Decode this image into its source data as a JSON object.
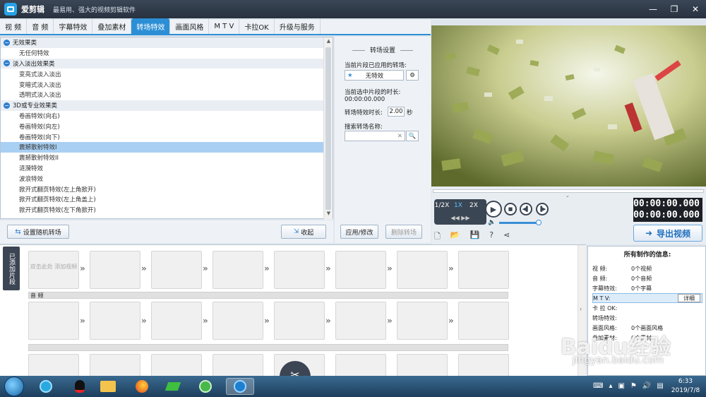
{
  "app": {
    "name": "爱剪辑",
    "slogan": "最易用、强大的视频剪辑软件"
  },
  "tabs": [
    {
      "label": "视  频"
    },
    {
      "label": "音  频"
    },
    {
      "label": "字幕特效"
    },
    {
      "label": "叠加素材"
    },
    {
      "label": "转场特效",
      "active": true
    },
    {
      "label": "画面风格"
    },
    {
      "label": "M T V"
    },
    {
      "label": "卡拉OK"
    },
    {
      "label": "升级与服务"
    }
  ],
  "effects": {
    "categories": [
      {
        "name": "无效果类",
        "items": [
          "无任何特效"
        ]
      },
      {
        "name": "淡入淡出效果类",
        "items": [
          "变亮式淡入淡出",
          "变暗式淡入淡出",
          "透明式淡入淡出"
        ]
      },
      {
        "name": "3D或专业效果类",
        "items": [
          "卷画特效(向右)",
          "卷画特效(向左)",
          "卷画特效(向下)",
          "震撼散射特效I",
          "震撼散射特效II",
          "涟漪特效",
          "波浪特效",
          "掀开式翻页特效(左上角掀开)",
          "掀开式翻页特效(左上角盖上)",
          "掀开式翻页特效(左下角掀开)"
        ]
      }
    ],
    "selected": "震撼散射特效I"
  },
  "left_buttons": {
    "random": "设置随机转场",
    "collapse": "收起"
  },
  "settings": {
    "heading": "转场设置",
    "applied_label": "当前片段已应用的转场:",
    "applied_value": "无特效",
    "duration_label": "当前选中片段的时长:",
    "duration_value": "00:00:00.000",
    "effect_duration_label": "转场特效时长:",
    "effect_duration_value": "2.00",
    "effect_duration_unit": "秒",
    "search_label": "搜索转场名称:",
    "search_value": "",
    "apply_button": "应用/修改",
    "delete_button": "删除转场"
  },
  "player": {
    "speeds": [
      "1/2X",
      "1X",
      "2X"
    ],
    "active_speed": "1X",
    "time_current": "00:00:00.000",
    "time_total": "00:00:00.000",
    "export_label": "导出视频",
    "volume_level": 0.7
  },
  "timeline": {
    "side_label": "已添加片段",
    "first_clip_text": "双击此处 添加视频",
    "audio_label": "音 频"
  },
  "info": {
    "title": "所有制作的信息:",
    "rows": [
      {
        "k": "视    频:",
        "v": "0个视频"
      },
      {
        "k": "音    频:",
        "v": "0个音频"
      },
      {
        "k": "字幕特效:",
        "v": "0个字幕"
      },
      {
        "k": "M  T  V:",
        "v": ""
      },
      {
        "k": "卡 拉 OK:",
        "v": ""
      },
      {
        "k": "转场特效:",
        "v": ""
      },
      {
        "k": "画面风格:",
        "v": "0个画面风格"
      },
      {
        "k": "叠加素材:",
        "v": "0个素材"
      }
    ],
    "detail_button": "详细"
  },
  "taskbar": {
    "time": "6:33",
    "date": "2019/7/8"
  },
  "watermark": {
    "brand": "Baidu经验",
    "url": "jingyan.baidu.com"
  },
  "colors": {
    "accent": "#2c8fd6",
    "selection": "#a9d0f3",
    "titlebar": "#2f3a48"
  }
}
